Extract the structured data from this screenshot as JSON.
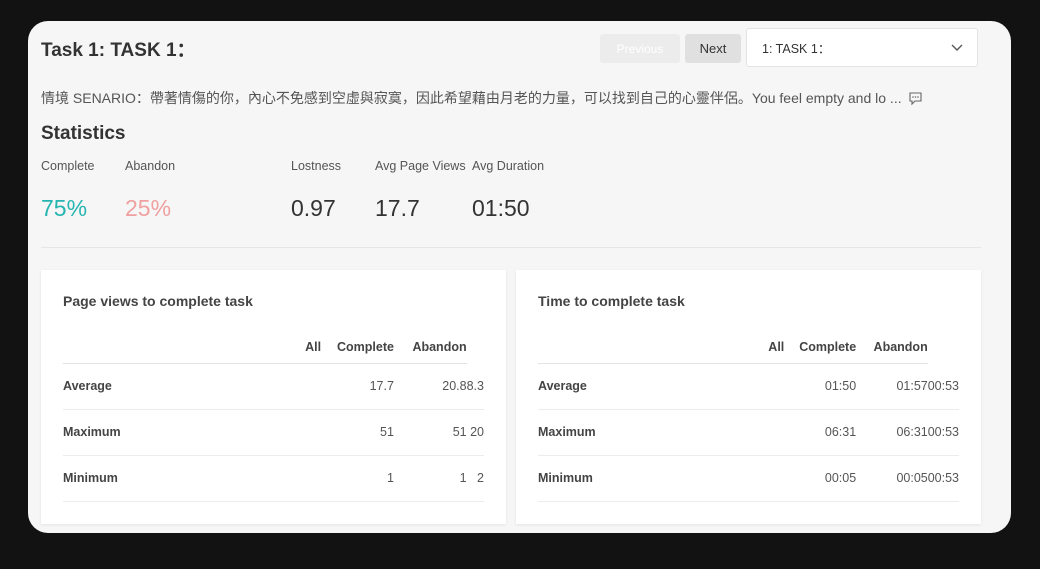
{
  "header": {
    "title": "Task 1: TASK 1：",
    "prev_label": "Previous",
    "next_label": "Next",
    "task_select": "1: TASK 1："
  },
  "scenario": "情境 SENARIO：帶著情傷的你，內心不免感到空虛與寂寞，因此希望藉由月老的力量，可以找到自己的心靈伴侶。You feel empty and lo ...",
  "statistics": {
    "title": "Statistics",
    "complete_label": "Complete",
    "complete_value": "75%",
    "abandon_label": "Abandon",
    "abandon_value": "25%",
    "lostness_label": "Lostness",
    "lostness_value": "0.97",
    "avg_page_views_label": "Avg Page Views",
    "avg_page_views_value": "17.7",
    "avg_duration_label": "Avg Duration",
    "avg_duration_value": "01:50"
  },
  "page_views": {
    "title": "Page views to complete task",
    "columns": [
      "All",
      "Complete",
      "Abandon"
    ],
    "rows": [
      {
        "label": "Average",
        "all": "17.7",
        "complete": "20.8",
        "abandon": "8.3"
      },
      {
        "label": "Maximum",
        "all": "51",
        "complete": "51",
        "abandon": "20"
      },
      {
        "label": "Minimum",
        "all": "1",
        "complete": "1",
        "abandon": "2"
      }
    ]
  },
  "time": {
    "title": "Time to complete task",
    "columns": [
      "All",
      "Complete",
      "Abandon"
    ],
    "rows": [
      {
        "label": "Average",
        "all": "01:50",
        "complete": "01:57",
        "abandon": "00:53"
      },
      {
        "label": "Maximum",
        "all": "06:31",
        "complete": "06:31",
        "abandon": "00:53"
      },
      {
        "label": "Minimum",
        "all": "00:05",
        "complete": "00:05",
        "abandon": "00:53"
      }
    ]
  },
  "icons": {
    "select_chevron": "chevron-down-icon",
    "scenario_more": "comment-icon"
  },
  "colors": {
    "complete": "#26b5b0",
    "abandon": "#f0a0a0"
  }
}
